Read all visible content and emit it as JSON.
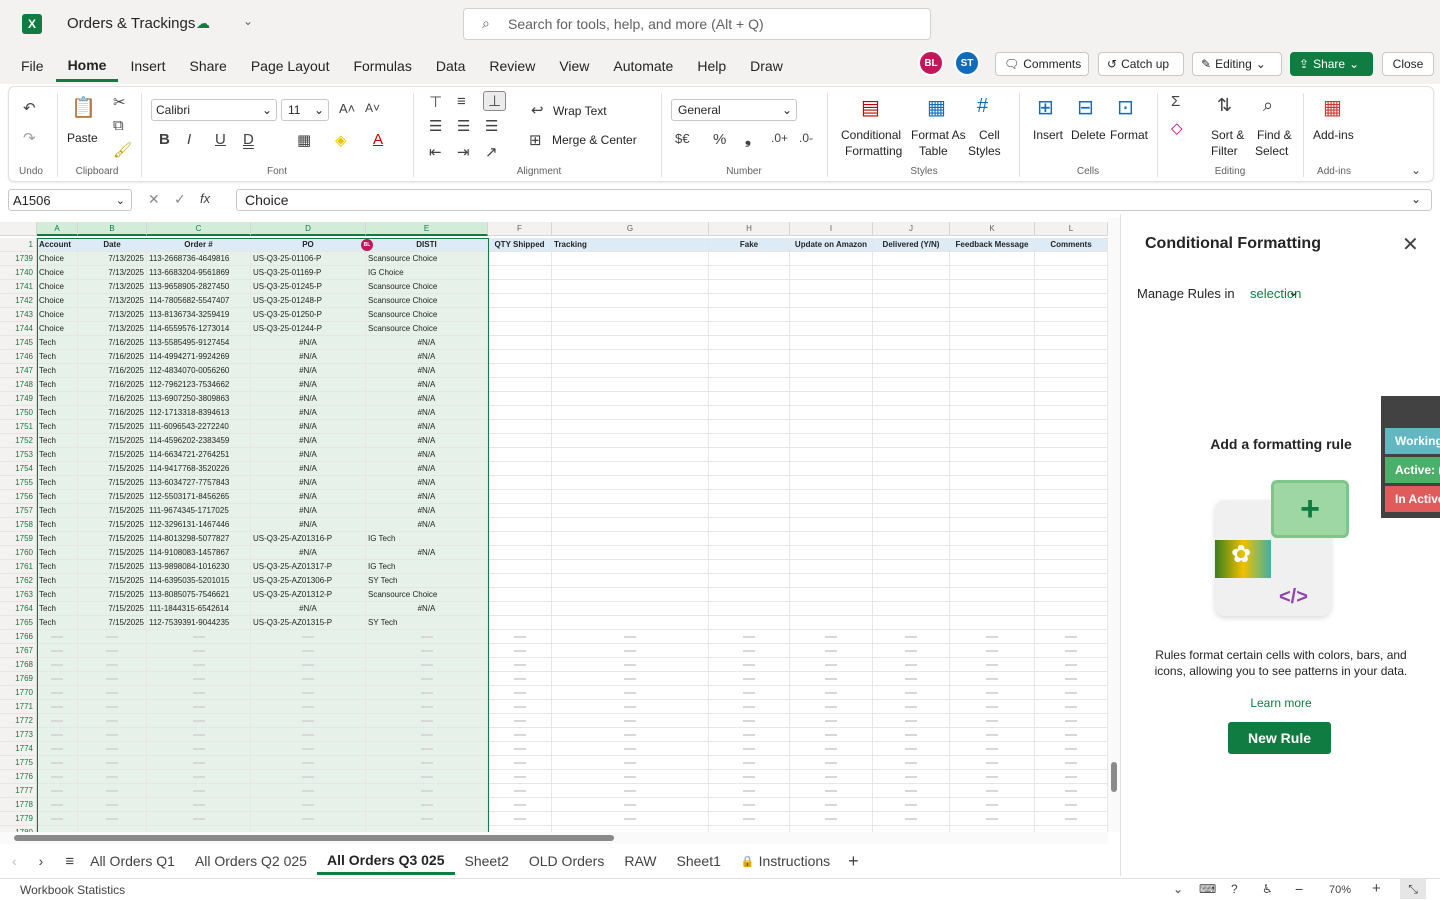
{
  "app": {
    "title": "Orders & Trackings",
    "search_placeholder": "Search for tools, help, and more (Alt + Q)"
  },
  "menu_tabs": [
    "File",
    "Home",
    "Insert",
    "Share",
    "Page Layout",
    "Formulas",
    "Data",
    "Review",
    "View",
    "Automate",
    "Help",
    "Draw"
  ],
  "active_menu": "Home",
  "collab": {
    "avatar1": "BL",
    "avatar2": "ST",
    "comments": "Comments",
    "catchup": "Catch up",
    "editing": "Editing",
    "share": "Share",
    "close": "Close"
  },
  "ribbon": {
    "undo_group": "Undo",
    "paste": "Paste",
    "clipboard_group": "Clipboard",
    "font_name": "Calibri",
    "font_size": "11",
    "font_group": "Font",
    "wrap_text": "Wrap Text",
    "merge_center": "Merge & Center",
    "alignment_group": "Alignment",
    "number_format": "General",
    "number_group": "Number",
    "cond_format_1": "Conditional",
    "cond_format_2": "Formatting",
    "format_table_1": "Format As",
    "format_table_2": "Table",
    "cell_styles_1": "Cell",
    "cell_styles_2": "Styles",
    "styles_group": "Styles",
    "insert": "Insert",
    "delete": "Delete",
    "format": "Format",
    "cells_group": "Cells",
    "sort_1": "Sort &",
    "sort_2": "Filter",
    "find_1": "Find &",
    "find_2": "Select",
    "editing_group": "Editing",
    "addins": "Add-ins",
    "addins_group": "Add-ins"
  },
  "formula_bar": {
    "name_box": "A1506",
    "value": "Choice"
  },
  "grid": {
    "columns": [
      "A",
      "B",
      "C",
      "D",
      "E",
      "F",
      "G",
      "H",
      "I",
      "J",
      "K",
      "L"
    ],
    "headers": [
      "Account",
      "Date",
      "Order #",
      "PO",
      "DISTI",
      "QTY Shipped",
      "Tracking",
      "Fake",
      "Update on Amazon",
      "Delivered (Y/N)",
      "Feedback Message",
      "Comments"
    ],
    "header_row_num": "1",
    "rows": [
      [
        "1739",
        "Choice",
        "7/13/2025",
        "113-2668736-4649816",
        "US-Q3-25-01106-P",
        "Scansource Choice"
      ],
      [
        "1740",
        "Choice",
        "7/13/2025",
        "113-6683204-9561869",
        "US-Q3-25-01169-P",
        "IG Choice"
      ],
      [
        "1741",
        "Choice",
        "7/13/2025",
        "113-9658905-2827450",
        "US-Q3-25-01245-P",
        "Scansource Choice"
      ],
      [
        "1742",
        "Choice",
        "7/13/2025",
        "114-7805682-5547407",
        "US-Q3-25-01248-P",
        "Scansource Choice"
      ],
      [
        "1743",
        "Choice",
        "7/13/2025",
        "113-8136734-3259419",
        "US-Q3-25-01250-P",
        "Scansource Choice"
      ],
      [
        "1744",
        "Choice",
        "7/13/2025",
        "114-6559576-1273014",
        "US-Q3-25-01244-P",
        "Scansource Choice"
      ],
      [
        "1745",
        "Tech",
        "7/16/2025",
        "113-5585495-9127454",
        "#N/A",
        "#N/A"
      ],
      [
        "1746",
        "Tech",
        "7/16/2025",
        "114-4994271-9924269",
        "#N/A",
        "#N/A"
      ],
      [
        "1747",
        "Tech",
        "7/16/2025",
        "112-4834070-0056260",
        "#N/A",
        "#N/A"
      ],
      [
        "1748",
        "Tech",
        "7/16/2025",
        "112-7962123-7534662",
        "#N/A",
        "#N/A"
      ],
      [
        "1749",
        "Tech",
        "7/16/2025",
        "113-6907250-3809863",
        "#N/A",
        "#N/A"
      ],
      [
        "1750",
        "Tech",
        "7/16/2025",
        "112-1713318-8394613",
        "#N/A",
        "#N/A"
      ],
      [
        "1751",
        "Tech",
        "7/15/2025",
        "111-6096543-2272240",
        "#N/A",
        "#N/A"
      ],
      [
        "1752",
        "Tech",
        "7/15/2025",
        "114-4596202-2383459",
        "#N/A",
        "#N/A"
      ],
      [
        "1753",
        "Tech",
        "7/15/2025",
        "114-6634721-2764251",
        "#N/A",
        "#N/A"
      ],
      [
        "1754",
        "Tech",
        "7/15/2025",
        "114-9417768-3520226",
        "#N/A",
        "#N/A"
      ],
      [
        "1755",
        "Tech",
        "7/15/2025",
        "113-6034727-7757843",
        "#N/A",
        "#N/A"
      ],
      [
        "1756",
        "Tech",
        "7/15/2025",
        "112-5503171-8456265",
        "#N/A",
        "#N/A"
      ],
      [
        "1757",
        "Tech",
        "7/15/2025",
        "111-9674345-1717025",
        "#N/A",
        "#N/A"
      ],
      [
        "1758",
        "Tech",
        "7/15/2025",
        "112-3296131-1467446",
        "#N/A",
        "#N/A"
      ],
      [
        "1759",
        "Tech",
        "7/15/2025",
        "114-8013298-5077827",
        "US-Q3-25-AZ01316-P",
        "IG Tech"
      ],
      [
        "1760",
        "Tech",
        "7/15/2025",
        "114-9108083-1457867",
        "#N/A",
        "#N/A"
      ],
      [
        "1761",
        "Tech",
        "7/15/2025",
        "113-9898084-1016230",
        "US-Q3-25-AZ01317-P",
        "IG Tech"
      ],
      [
        "1762",
        "Tech",
        "7/15/2025",
        "114-6395035-5201015",
        "US-Q3-25-AZ01306-P",
        "SY Tech"
      ],
      [
        "1763",
        "Tech",
        "7/15/2025",
        "113-8085075-7546621",
        "US-Q3-25-AZ01312-P",
        "Scansource Choice"
      ],
      [
        "1764",
        "Tech",
        "7/15/2025",
        "111-1844315-6542614",
        "#N/A",
        "#N/A"
      ],
      [
        "1765",
        "Tech",
        "7/15/2025",
        "112-7539391-9044235",
        "US-Q3-25-AZ01315-P",
        "SY Tech"
      ]
    ],
    "empty_rows": [
      "1766",
      "1767",
      "1768",
      "1769",
      "1770",
      "1771",
      "1772",
      "1773",
      "1774",
      "1775",
      "1776",
      "1777",
      "1778",
      "1779",
      "1780"
    ],
    "presence_badge": "BL"
  },
  "sheets": [
    "All Orders Q1",
    "All Orders Q2 025",
    "All Orders Q3 025",
    "Sheet2",
    "OLD Orders",
    "RAW",
    "Sheet1",
    "Instructions"
  ],
  "active_sheet": "All Orders Q3 025",
  "status": {
    "left": "Workbook Statistics",
    "zoom": "70%"
  },
  "panel": {
    "title": "Conditional Formatting",
    "manage_label": "Manage Rules in",
    "manage_value": "selection",
    "heading": "Add a formatting rule",
    "description": "Rules format certain cells with colors, bars, and icons, allowing you to see patterns in your data.",
    "learn_more": "Learn more",
    "new_rule": "New Rule"
  },
  "float_tags": [
    "Working",
    "Active: (",
    "In Active"
  ],
  "colors": {
    "brand": "#107c41",
    "avatar1": "#c2185b",
    "avatar2": "#0f6cbd",
    "selection": "#d3ecd9"
  }
}
